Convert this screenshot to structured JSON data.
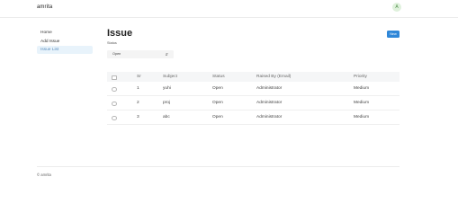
{
  "header": {
    "brand": "amrita",
    "avatar_initial": "A"
  },
  "sidebar": {
    "items": [
      {
        "label": "Home",
        "active": false
      },
      {
        "label": "Add Issue",
        "active": false
      },
      {
        "label": "Issue List",
        "active": true
      }
    ]
  },
  "main": {
    "title": "Issue",
    "new_button": "New",
    "status_label": "Status",
    "status_value": "Open",
    "table": {
      "headers": [
        "Sr",
        "Subject",
        "Status",
        "Raised By (Email)",
        "Priority"
      ],
      "rows": [
        {
          "sr": "1",
          "subject": "yuhi",
          "status": "Open",
          "raised_by": "Administrator",
          "priority": "Medium"
        },
        {
          "sr": "2",
          "subject": "proj",
          "status": "Open",
          "raised_by": "Administrator",
          "priority": "Medium"
        },
        {
          "sr": "3",
          "subject": "abc",
          "status": "Open",
          "raised_by": "Administrator",
          "priority": "Medium"
        }
      ]
    }
  },
  "footer": {
    "text": "© amrita"
  },
  "colors": {
    "primary": "#2f87d8",
    "active_bg": "#e8f3fb",
    "avatar_bg": "#dff1dc"
  }
}
